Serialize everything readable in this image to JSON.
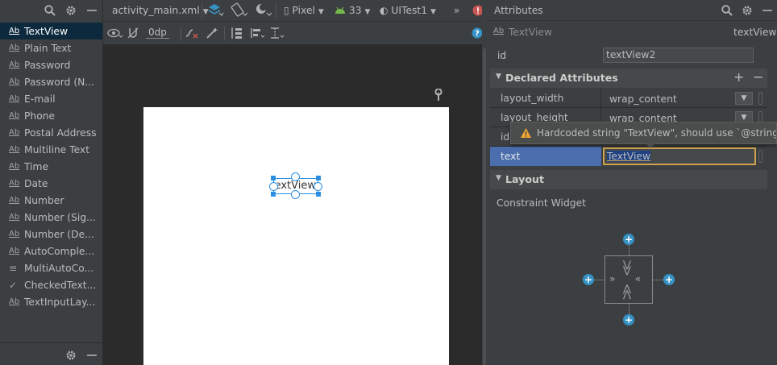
{
  "palette": {
    "items": [
      {
        "icon": "Ab",
        "label": "TextView",
        "selected": true
      },
      {
        "icon": "Ab",
        "label": "Plain Text"
      },
      {
        "icon": "Ab",
        "label": "Password"
      },
      {
        "icon": "Ab",
        "label": "Password (N..."
      },
      {
        "icon": "Ab",
        "label": "E-mail"
      },
      {
        "icon": "Ab",
        "label": "Phone"
      },
      {
        "icon": "Ab",
        "label": "Postal Address"
      },
      {
        "icon": "Ab",
        "label": "Multiline Text"
      },
      {
        "icon": "Ab",
        "label": "Time"
      },
      {
        "icon": "Ab",
        "label": "Date"
      },
      {
        "icon": "Ab",
        "label": "Number"
      },
      {
        "icon": "Ab",
        "label": "Number (Sig..."
      },
      {
        "icon": "Ab",
        "label": "Number (De..."
      },
      {
        "icon": "Ab",
        "label": "AutoComple..."
      },
      {
        "icon": "≡",
        "label": "MultiAutoCo..."
      },
      {
        "icon": "✓",
        "label": "CheckedText..."
      },
      {
        "icon": "Ab",
        "label": "TextInputLay..."
      }
    ]
  },
  "editor": {
    "file_tab": "activity_main.xml",
    "device": "Pixel",
    "api_level": "33",
    "theme": "UITest1",
    "margin_value": "0dp",
    "widget_text": "TextView"
  },
  "attributes": {
    "panel_title": "Attributes",
    "component_icon": "Ab",
    "component_type": "TextView",
    "component_id": "textView2",
    "id_label": "id",
    "id_value": "textView2",
    "declared_title": "Declared Attributes",
    "rows": [
      {
        "name": "layout_width",
        "value": "wrap_content"
      },
      {
        "name": "layout_height",
        "value": "wrap_content"
      },
      {
        "name": "id",
        "value": ""
      }
    ],
    "text_label": "text",
    "text_value": "TextView",
    "layout_title": "Layout",
    "constraint_label": "Constraint Widget"
  },
  "tooltip": {
    "message": "Hardcoded string \"TextView\", should use `@string` resourc"
  },
  "colors": {
    "selection_blue": "#2a8fe3",
    "row_highlight": "#4b6eaf",
    "warning": "#f0a732",
    "plus_blue": "#3592c4",
    "error_red": "#c75450"
  }
}
